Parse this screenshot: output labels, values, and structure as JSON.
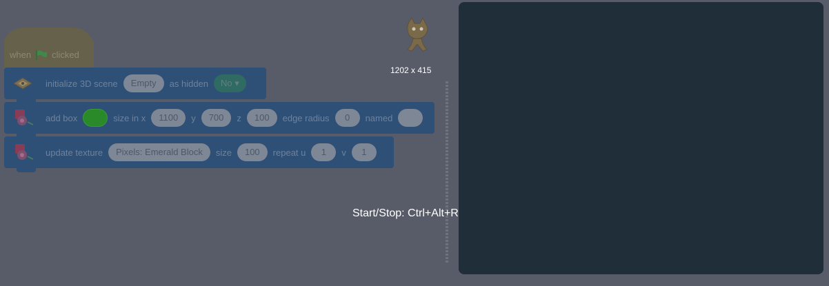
{
  "hat": {
    "prefix": "when",
    "flag_icon": "green-flag-icon",
    "suffix": "clicked"
  },
  "init_block": {
    "label1": "initialize 3D scene",
    "scene_value": "Empty",
    "label2": "as hidden",
    "hidden_value": "No ▾"
  },
  "box_block": {
    "label1": "add box",
    "color": "#2a8a2a",
    "label2": "size in x",
    "x_value": "1100",
    "label3": "y",
    "y_value": "700",
    "label4": "z",
    "z_value": "100",
    "label5": "edge radius",
    "radius_value": "0",
    "label6": "named",
    "name_value": ""
  },
  "texture_block": {
    "label1": "update texture",
    "texture_value": "Pixels: Emerald Block",
    "label2": "size",
    "size_value": "100",
    "label3": "repeat u",
    "u_value": "1",
    "label4": "v",
    "v_value": "1"
  },
  "dimensions_text": "1202 x 415",
  "hint_text": "Start/Stop: Ctrl+Alt+R",
  "colors": {
    "background": "#585c68",
    "stage": "#1f2e39",
    "block": "#2e4f76"
  }
}
